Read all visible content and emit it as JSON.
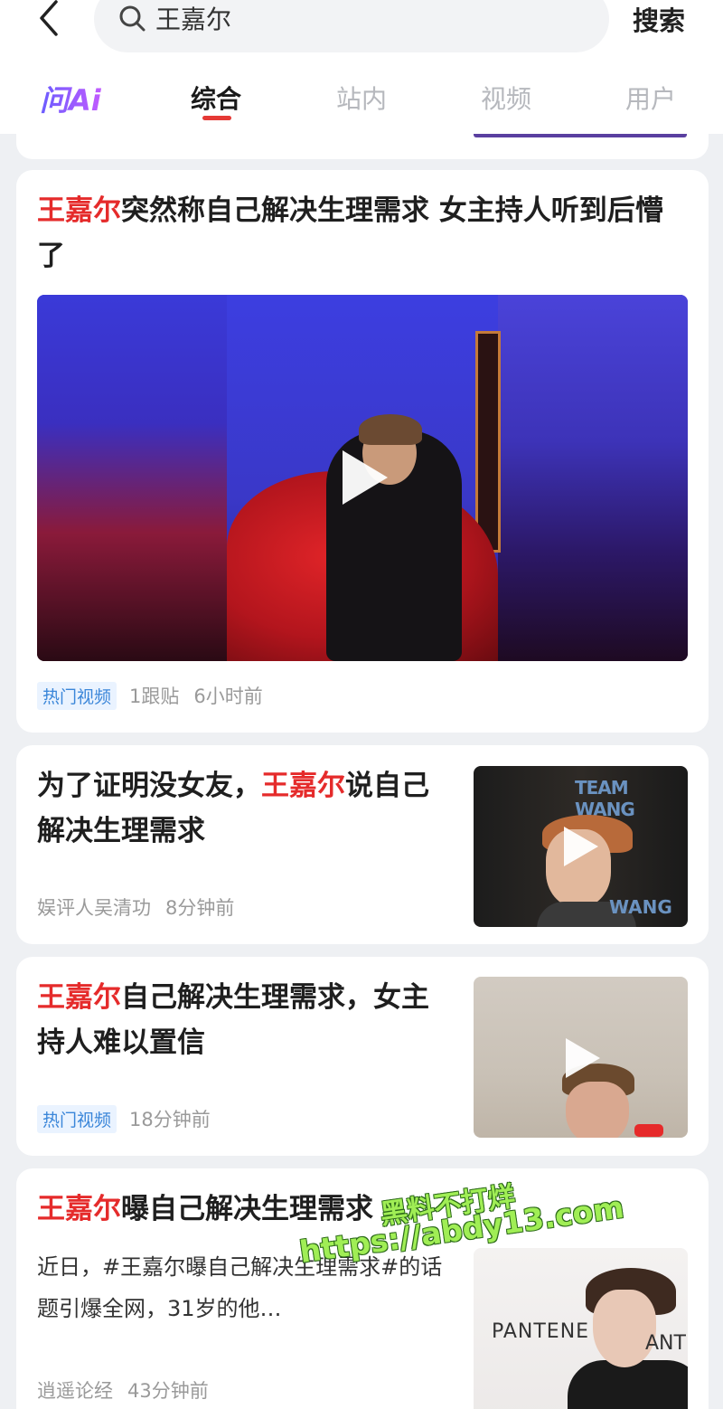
{
  "header": {
    "search_query": "王嘉尔",
    "search_button": "搜索"
  },
  "tabs": {
    "ai_label": "问Ai",
    "items": [
      "综合",
      "站内",
      "视频",
      "用户"
    ],
    "active_index": 0
  },
  "results": [
    {
      "highlight": "王嘉尔",
      "title_rest": "突然称自己解决生理需求 女主持人听到后懵了",
      "badge": "热门视频",
      "replies": "1跟贴",
      "time": "6小时前"
    },
    {
      "title_pre": "为了证明没女友，",
      "highlight": "王嘉尔",
      "title_rest": "说自己解决生理需求",
      "source": "娱评人吴清功",
      "time": "8分钟前",
      "thumb_text_top": "TEAM WANG",
      "thumb_text_bottom": "WANG"
    },
    {
      "highlight": "王嘉尔",
      "title_rest": "自己解决生理需求，女主持人难以置信",
      "badge": "热门视频",
      "time": "18分钟前"
    },
    {
      "highlight": "王嘉尔",
      "title_rest": "曝自己解决生理需求",
      "summary": "近日，#王嘉尔曝自己解决生理需求#的话题引爆全网，31岁的他…",
      "source": "逍遥论经",
      "time": "43分钟前",
      "thumb_text_left": "PANTENE",
      "thumb_text_right": "ANT"
    }
  ],
  "watermark": {
    "line1": "黑料不打烊",
    "line2": "https://abdy13.com"
  },
  "colors": {
    "highlight": "#e52b2b",
    "badge_text": "#3a86d9",
    "tab_underline": "#e53935"
  }
}
